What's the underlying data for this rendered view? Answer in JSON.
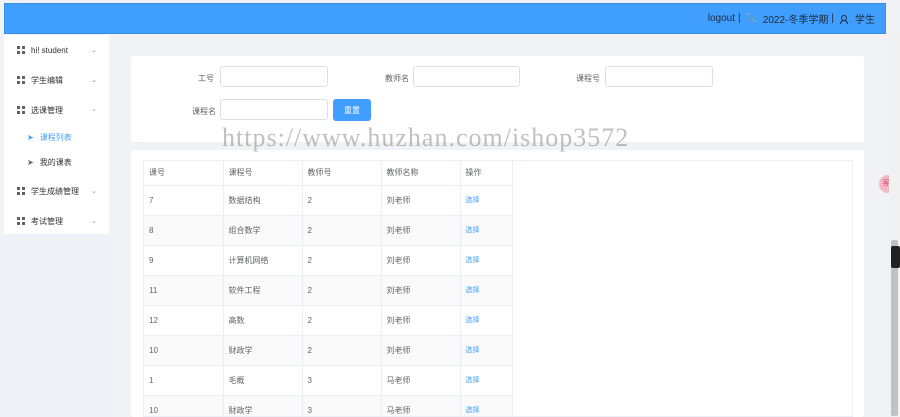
{
  "header": {
    "logout_label": "logout",
    "separator": "|",
    "semester": "2022-冬季学期",
    "role": "学生"
  },
  "sidebar": {
    "items": [
      {
        "label": "hi! student"
      },
      {
        "label": "学生编辑"
      },
      {
        "label": "选课管理"
      },
      {
        "label": "课程列表"
      },
      {
        "label": "我的课表"
      },
      {
        "label": "学生成绩管理"
      },
      {
        "label": "考试管理"
      }
    ]
  },
  "search": {
    "fields": [
      {
        "label": "工号",
        "value": ""
      },
      {
        "label": "教师名",
        "value": ""
      },
      {
        "label": "课程号",
        "value": ""
      },
      {
        "label": "课程名",
        "value": ""
      }
    ],
    "reset_label": "重置"
  },
  "table": {
    "headers": [
      "课号",
      "课程号",
      "教师号",
      "教师名称",
      "操作"
    ],
    "rows": [
      [
        "7",
        "数据结构",
        "2",
        "刘老师",
        "选择"
      ],
      [
        "8",
        "组合数学",
        "2",
        "刘老师",
        "选择"
      ],
      [
        "9",
        "计算机网络",
        "2",
        "刘老师",
        "选择"
      ],
      [
        "11",
        "软件工程",
        "2",
        "刘老师",
        "选择"
      ],
      [
        "12",
        "高数",
        "2",
        "刘老师",
        "选择"
      ],
      [
        "10",
        "财政学",
        "2",
        "刘老师",
        "选择"
      ],
      [
        "1",
        "毛概",
        "3",
        "马老师",
        "选择"
      ],
      [
        "10",
        "财政学",
        "3",
        "马老师",
        "选择"
      ]
    ]
  },
  "watermark": "https://www.huzhan.com/ishop3572",
  "floating_badge": "客",
  "colors": {
    "accent": "#409eff",
    "header_bg": "#409eff",
    "page_bg": "#f0f2f5",
    "sidebar_under_bg": "#eef1f6"
  },
  "icons": {
    "menu": "grid-icon",
    "submenu": "paper-plane-icon",
    "header_semester": "paperclip-icon",
    "header_role": "user-icon"
  }
}
